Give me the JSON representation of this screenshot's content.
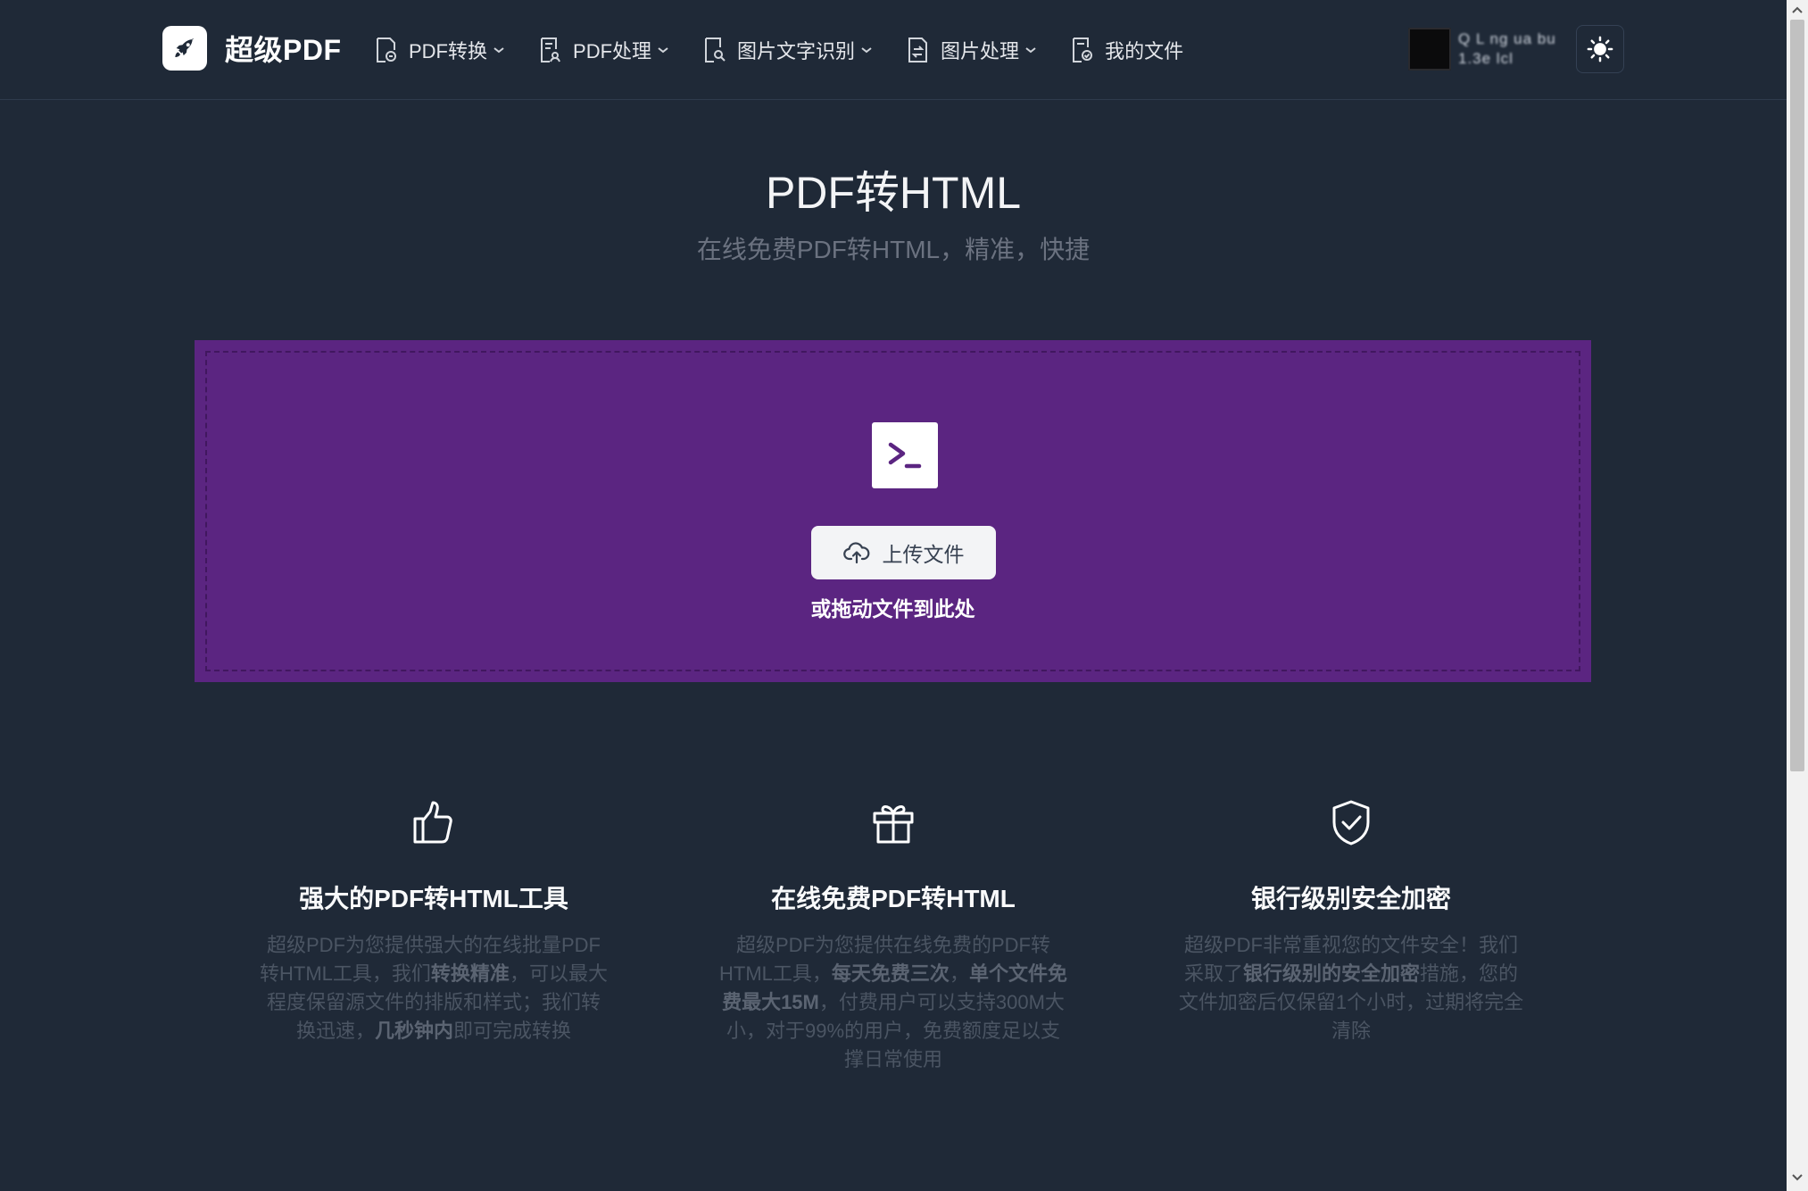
{
  "header": {
    "logo_text": "超级PDF",
    "nav": [
      {
        "label": "PDF转换",
        "dropdown": true
      },
      {
        "label": "PDF处理",
        "dropdown": true
      },
      {
        "label": "图片文字识别",
        "dropdown": true
      },
      {
        "label": "图片处理",
        "dropdown": true
      },
      {
        "label": "我的文件",
        "dropdown": false
      }
    ],
    "user": {
      "line1": "Q L ng ua bu",
      "line2": "1.3e lcl"
    }
  },
  "hero": {
    "title": "PDF转HTML",
    "subtitle": "在线免费PDF转HTML，精准，快捷"
  },
  "upload": {
    "button_label": "上传文件",
    "drop_hint": "或拖动文件到此处"
  },
  "features": [
    {
      "icon": "thumbs-up-icon",
      "title": "强大的PDF转HTML工具",
      "desc": [
        {
          "t": "超级PDF为您提供强大的在线批量PDF转HTML工具，我们",
          "b": false
        },
        {
          "t": "转换精准",
          "b": true
        },
        {
          "t": "，可以最大程度保留源文件的排版和样式；我们转换迅速，",
          "b": false
        },
        {
          "t": "几秒钟内",
          "b": true
        },
        {
          "t": "即可完成转换",
          "b": false
        }
      ]
    },
    {
      "icon": "gift-icon",
      "title": "在线免费PDF转HTML",
      "desc": [
        {
          "t": "超级PDF为您提供在线免费的PDF转HTML工具，",
          "b": false
        },
        {
          "t": "每天免费三次",
          "b": true
        },
        {
          "t": "，",
          "b": false
        },
        {
          "t": "单个文件免费最大15M",
          "b": true
        },
        {
          "t": "，付费用户可以支持300M大小，对于99%的用户，免费额度足以支撑日常使用",
          "b": false
        }
      ]
    },
    {
      "icon": "shield-check-icon",
      "title": "银行级别安全加密",
      "desc": [
        {
          "t": "超级PDF非常重视您的文件安全！我们采取了",
          "b": false
        },
        {
          "t": "银行级别的安全加密",
          "b": true
        },
        {
          "t": "措施，您的文件加密后仅保留1个小时，过期将完全清除",
          "b": false
        }
      ]
    }
  ],
  "colors": {
    "background": "#1f2937",
    "upload_zone": "#5b2581",
    "text_muted": "#6b7280"
  }
}
